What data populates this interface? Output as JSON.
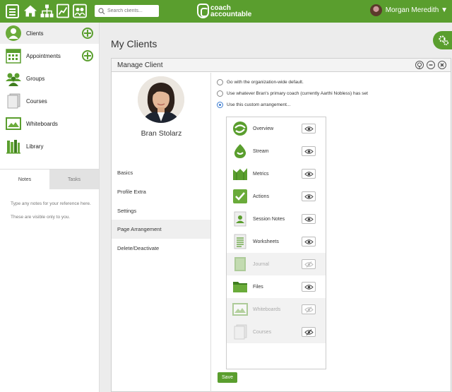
{
  "search": {
    "placeholder": "Search clients..."
  },
  "logo": {
    "line1": "coach",
    "line2": "accountable"
  },
  "user": {
    "name": "Morgan Meredith ▼"
  },
  "sidebar": {
    "items": [
      {
        "label": "Clients"
      },
      {
        "label": "Appointments"
      },
      {
        "label": "Groups"
      },
      {
        "label": "Courses"
      },
      {
        "label": "Whiteboards"
      },
      {
        "label": "Library"
      }
    ],
    "tabs": [
      {
        "label": "Notes"
      },
      {
        "label": "Tasks"
      }
    ],
    "notes": [
      "Type any notes for your reference here.",
      "These are visible only to you."
    ]
  },
  "main": {
    "title": "My Clients"
  },
  "panel": {
    "title": "Manage Client",
    "client_name": "Bran Stolarz",
    "menu": [
      {
        "label": "Basics"
      },
      {
        "label": "Profile Extra"
      },
      {
        "label": "Settings"
      },
      {
        "label": "Page Arrangement"
      },
      {
        "label": "Delete/Deactivate"
      }
    ],
    "options": [
      {
        "label": "Go with the organization-wide default.",
        "checked": false
      },
      {
        "label": "Use whatever Bran's primary coach (currently Aarthi Nobless) has set",
        "checked": false
      },
      {
        "label": "Use this custom arrangement...",
        "checked": true
      }
    ],
    "pages": [
      {
        "label": "Overview",
        "visible": true,
        "icon": "overview-icon"
      },
      {
        "label": "Stream",
        "visible": true,
        "icon": "stream-icon"
      },
      {
        "label": "Metrics",
        "visible": true,
        "icon": "metrics-icon"
      },
      {
        "label": "Actions",
        "visible": true,
        "icon": "actions-icon"
      },
      {
        "label": "Session Notes",
        "visible": true,
        "icon": "session-notes-icon"
      },
      {
        "label": "Worksheets",
        "visible": true,
        "icon": "worksheets-icon"
      },
      {
        "label": "Journal",
        "visible": false,
        "icon": "journal-icon"
      },
      {
        "label": "Files",
        "visible": true,
        "icon": "files-icon"
      },
      {
        "label": "Whiteboards",
        "visible": false,
        "icon": "whiteboards-icon"
      },
      {
        "label": "Courses",
        "visible": false,
        "icon": "courses-icon"
      }
    ],
    "save_label": "Save"
  },
  "colors": {
    "brand": "#5a9e2e",
    "radio_selected": "#3b7bd0"
  }
}
